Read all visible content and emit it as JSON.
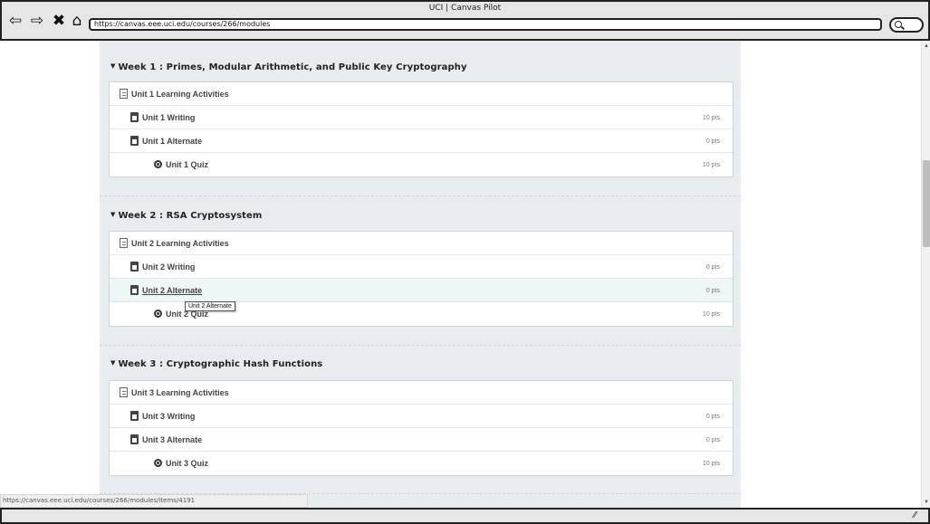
{
  "window": {
    "title": "UCI | Canvas Pilot"
  },
  "toolbar": {
    "back_icon": "⇦",
    "forward_icon": "⇨",
    "stop_icon": "✖",
    "home_icon": "⌂",
    "url": "https://canvas.eee.uci.edu/courses/266/modules"
  },
  "modules": [
    {
      "title": "Week 1 : Primes, Modular Arithmetic, and Public Key Cryptography",
      "items": [
        {
          "label": "Unit 1 Learning Activities",
          "type": "page",
          "points": ""
        },
        {
          "label": "Unit 1 Writing",
          "type": "assignment",
          "points": "10 pts"
        },
        {
          "label": "Unit 1 Alternate",
          "type": "assignment",
          "points": "0 pts"
        },
        {
          "label": "Unit 1 Quiz",
          "type": "quiz",
          "points": "10 pts"
        }
      ]
    },
    {
      "title": "Week 2 : RSA Cryptosystem",
      "items": [
        {
          "label": "Unit 2 Learning Activities",
          "type": "page",
          "points": ""
        },
        {
          "label": "Unit 2 Writing",
          "type": "assignment",
          "points": "0 pts"
        },
        {
          "label": "Unit 2 Alternate",
          "type": "assignment",
          "points": "0 pts"
        },
        {
          "label": "Unit 2 Quiz",
          "type": "quiz",
          "points": "10 pts"
        }
      ]
    },
    {
      "title": "Week 3 : Cryptographic Hash Functions",
      "items": [
        {
          "label": "Unit 3 Learning Activities",
          "type": "page",
          "points": ""
        },
        {
          "label": "Unit 3 Writing",
          "type": "assignment",
          "points": "0 pts"
        },
        {
          "label": "Unit 3 Alternate",
          "type": "assignment",
          "points": "0 pts"
        },
        {
          "label": "Unit 3 Quiz",
          "type": "quiz",
          "points": "10 pts"
        }
      ]
    }
  ],
  "tooltip": {
    "text": "Unit 2 Alternate"
  },
  "status_bar": {
    "url": "https://canvas.eee.uci.edu/courses/266/modules/items/4191"
  }
}
